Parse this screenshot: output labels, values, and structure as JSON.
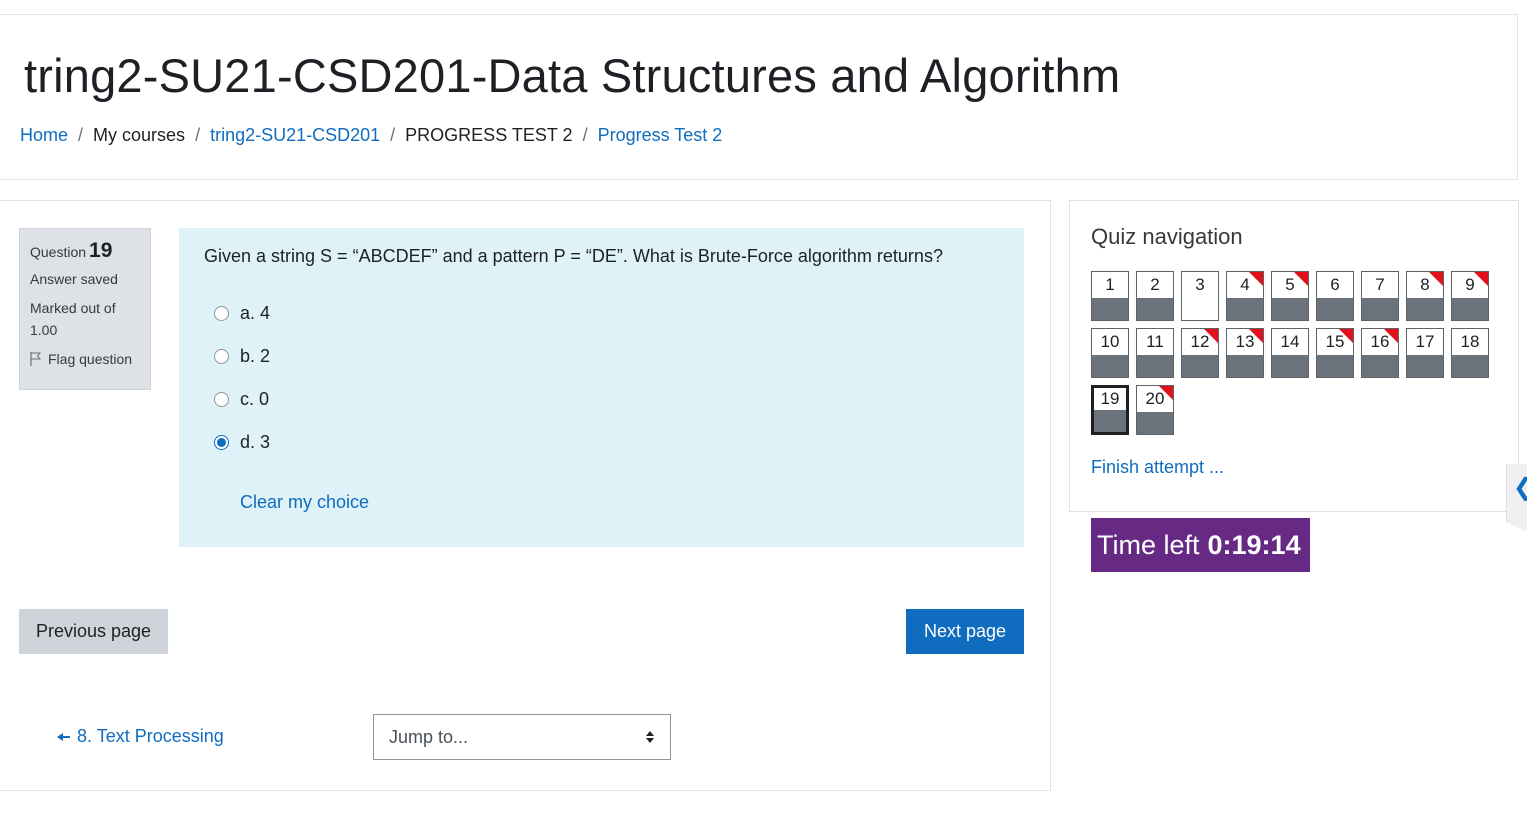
{
  "header": {
    "course_title": "tring2-SU21-CSD201-Data Structures and Algorithm",
    "breadcrumb": [
      {
        "label": "Home",
        "link": true
      },
      {
        "label": "My courses",
        "link": false
      },
      {
        "label": "tring2-SU21-CSD201",
        "link": true
      },
      {
        "label": "PROGRESS TEST 2",
        "link": false
      },
      {
        "label": "Progress Test 2",
        "link": true
      }
    ]
  },
  "question_info": {
    "question_label": "Question",
    "question_number": "19",
    "state": "Answer saved",
    "grade": "Marked out of 1.00",
    "flag_label": "Flag question"
  },
  "question": {
    "text": "Given a string S = “ABCDEF” and a pattern P = “DE”. What is Brute-Force algorithm returns?",
    "answers": [
      {
        "label": "a. 4",
        "selected": false
      },
      {
        "label": "b. 2",
        "selected": false
      },
      {
        "label": "c. 0",
        "selected": false
      },
      {
        "label": "d. 3",
        "selected": true
      }
    ],
    "clear_label": "Clear my choice"
  },
  "navigation_buttons": {
    "previous": "Previous page",
    "next": "Next page"
  },
  "footer": {
    "prev_activity": "8. Text Processing",
    "jump_placeholder": "Jump to..."
  },
  "quiz_nav": {
    "title": "Quiz navigation",
    "questions": [
      {
        "n": "1",
        "answered": true,
        "flagged": false
      },
      {
        "n": "2",
        "answered": true,
        "flagged": false
      },
      {
        "n": "3",
        "answered": false,
        "flagged": false
      },
      {
        "n": "4",
        "answered": true,
        "flagged": true
      },
      {
        "n": "5",
        "answered": true,
        "flagged": true
      },
      {
        "n": "6",
        "answered": true,
        "flagged": false
      },
      {
        "n": "7",
        "answered": true,
        "flagged": false
      },
      {
        "n": "8",
        "answered": true,
        "flagged": true
      },
      {
        "n": "9",
        "answered": true,
        "flagged": true
      },
      {
        "n": "10",
        "answered": true,
        "flagged": false
      },
      {
        "n": "11",
        "answered": true,
        "flagged": false
      },
      {
        "n": "12",
        "answered": true,
        "flagged": true
      },
      {
        "n": "13",
        "answered": true,
        "flagged": true
      },
      {
        "n": "14",
        "answered": true,
        "flagged": false
      },
      {
        "n": "15",
        "answered": true,
        "flagged": true
      },
      {
        "n": "16",
        "answered": true,
        "flagged": true
      },
      {
        "n": "17",
        "answered": true,
        "flagged": false
      },
      {
        "n": "18",
        "answered": true,
        "flagged": false
      },
      {
        "n": "19",
        "answered": true,
        "flagged": false,
        "current": true
      },
      {
        "n": "20",
        "answered": true,
        "flagged": true
      }
    ],
    "finish_label": "Finish attempt ..."
  },
  "timer": {
    "label": "Time left",
    "value": "0:19:14"
  },
  "icons": {
    "flag": "flag-icon",
    "prev_arrow": "arrow-left-icon",
    "select_caret": "sort-caret-icon",
    "drawer": "chevron-left-icon"
  },
  "colors": {
    "link": "#0f6cbf",
    "question_bg": "#def2f8",
    "info_bg": "#dee2e6",
    "timer_bg": "#662a85",
    "flag": "#e0111b",
    "answered_bar": "#6a737b"
  }
}
